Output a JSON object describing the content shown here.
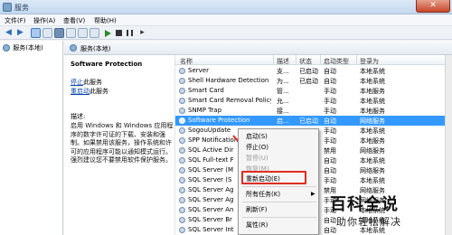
{
  "window": {
    "title": "服务"
  },
  "menubar": {
    "items": [
      "文件(F)",
      "操作(A)",
      "查看(V)",
      "帮助(H)"
    ]
  },
  "tree": {
    "root_label": "服务(本地)"
  },
  "pane": {
    "header_title": "服务(本地)"
  },
  "description": {
    "service_title": "Software Protection",
    "stop_link": "停止",
    "stop_suffix": "此服务",
    "restart_link": "重启动",
    "restart_suffix": "此服务",
    "desc_label": "描述:",
    "desc_text": "启用 Windows 和 Windows 应用程序的数字许可证的下载、安装和强制。如果禁用该服务，操作系统和许可的应用程序可能以通知模式运行。强烈建议您不要禁用软件保护服务。"
  },
  "list": {
    "columns": [
      "名称",
      "描述",
      "状态",
      "启动类型",
      "登录为"
    ],
    "rows": [
      {
        "name": "Server",
        "desc": "支...",
        "status": "已启动",
        "startup": "自动",
        "logon": "本地系统"
      },
      {
        "name": "Shell Hardware Detection",
        "desc": "为...",
        "status": "已启动",
        "startup": "自动",
        "logon": "本地系统"
      },
      {
        "name": "Smart Card",
        "desc": "管...",
        "status": "",
        "startup": "手动",
        "logon": "本地服务"
      },
      {
        "name": "Smart Card Removal Policy",
        "desc": "允...",
        "status": "",
        "startup": "手动",
        "logon": "本地系统"
      },
      {
        "name": "SNMP Trap",
        "desc": "接...",
        "status": "",
        "startup": "手动",
        "logon": "本地服务"
      },
      {
        "name": "Software Protection",
        "desc": "启...",
        "status": "已启动",
        "startup": "自动",
        "logon": "网络服务"
      },
      {
        "name": "SogouUpdate",
        "desc": "",
        "status": "",
        "startup": "手动",
        "logon": "本地系统"
      },
      {
        "name": "SPP Notification",
        "desc": "",
        "status": "",
        "startup": "手动",
        "logon": "本地服务"
      },
      {
        "name": "SQL Active Dir",
        "desc": "",
        "status": "",
        "startup": "禁用",
        "logon": "网络服务"
      },
      {
        "name": "SQL Full-text F",
        "desc": "",
        "status": "",
        "startup": "自动",
        "logon": "本地系统"
      },
      {
        "name": "SQL Server (M",
        "desc": "",
        "status": "",
        "startup": "自动",
        "logon": "网络服务"
      },
      {
        "name": "SQL Server (S",
        "desc": "",
        "status": "",
        "startup": "手动",
        "logon": "本地系统"
      },
      {
        "name": "SQL Server Ag",
        "desc": "",
        "status": "",
        "startup": "禁用",
        "logon": "网络服务"
      },
      {
        "name": "SQL Server Ag",
        "desc": "",
        "status": "",
        "startup": "手动",
        "logon": "网络服务"
      },
      {
        "name": "SQL Server An",
        "desc": "",
        "status": "",
        "startup": "手动",
        "logon": "本地系统"
      },
      {
        "name": "SQL Server Br",
        "desc": "",
        "status": "",
        "startup": "自动",
        "logon": "本地系统"
      },
      {
        "name": "SQL Server Int",
        "desc": "",
        "status": "",
        "startup": "自动",
        "logon": "本地系统"
      }
    ]
  },
  "context_menu": {
    "items": [
      {
        "label": "启动(S)",
        "disabled": false
      },
      {
        "label": "停止(O)",
        "disabled": false
      },
      {
        "label": "暂停(U)",
        "disabled": true
      },
      {
        "label": "恢复(M)",
        "disabled": true
      },
      {
        "label": "重新启动(E)",
        "disabled": false
      },
      {
        "label": "所有任务(K)",
        "disabled": false
      },
      {
        "label": "刷新(F)",
        "disabled": false
      },
      {
        "label": "属性(R)",
        "disabled": false
      }
    ],
    "submenu_arrow": "▶"
  },
  "watermark": {
    "title": "百科全说",
    "subtitle": "助你轻松解决"
  },
  "colors": {
    "selection": "#3399ff",
    "highlight_box": "#e02b20",
    "link": "#0645ad"
  }
}
